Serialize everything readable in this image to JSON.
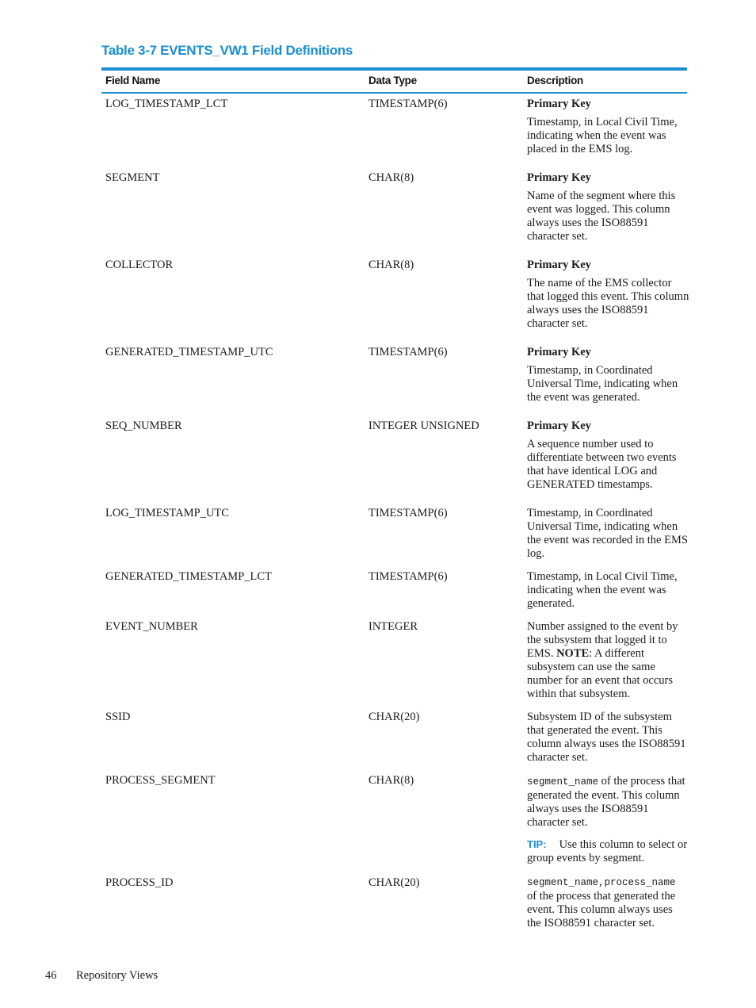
{
  "table": {
    "title": "Table 3-7 EVENTS_VW1 Field Definitions",
    "headers": [
      "Field Name",
      "Data Type",
      "Description"
    ],
    "rows": [
      {
        "field": "LOG_TIMESTAMP_LCT",
        "type": "TIMESTAMP(6)",
        "primary_key": "Primary Key",
        "description": "Timestamp, in Local Civil Time, indicating when the event was placed in the EMS log."
      },
      {
        "field": "SEGMENT",
        "type": "CHAR(8)",
        "primary_key": "Primary Key",
        "description": "Name of the segment where this event was logged. This column always uses the ISO88591 character set."
      },
      {
        "field": "COLLECTOR",
        "type": "CHAR(8)",
        "primary_key": "Primary Key",
        "description": "The name of the EMS collector that logged this event. This column always uses the ISO88591 character set."
      },
      {
        "field": "GENERATED_TIMESTAMP_UTC",
        "type": "TIMESTAMP(6)",
        "primary_key": "Primary Key",
        "description": "Timestamp, in Coordinated Universal Time, indicating when the event was generated."
      },
      {
        "field": "SEQ_NUMBER",
        "type": "INTEGER UNSIGNED",
        "primary_key": "Primary Key",
        "description": "A sequence number used to differentiate between two events that have identical LOG and GENERATED timestamps."
      },
      {
        "field": "LOG_TIMESTAMP_UTC",
        "type": "TIMESTAMP(6)",
        "description": "Timestamp, in Coordinated Universal Time, indicating when the event was recorded in the EMS log."
      },
      {
        "field": "GENERATED_TIMESTAMP_LCT",
        "type": "TIMESTAMP(6)",
        "description": "Timestamp, in Local Civil Time, indicating when the event was generated."
      },
      {
        "field": "EVENT_NUMBER",
        "type": "INTEGER",
        "description_pre": "Number assigned to the event by the subsystem that logged it to EMS.",
        "note_label": "NOTE",
        "description_post": ": A different subsystem can use the same number for an event that occurs within that subsystem."
      },
      {
        "field": "SSID",
        "type": "CHAR(20)",
        "description": "Subsystem ID of the subsystem that generated the event. This column always uses the ISO88591 character set."
      },
      {
        "field": "PROCESS_SEGMENT",
        "type": "CHAR(8)",
        "code": "segment_name",
        "description": " of the process that generated the event. This column always uses the ISO88591 character set.",
        "tip_label": "TIP:",
        "tip": "Use this column to select or group events by segment."
      },
      {
        "field": "PROCESS_ID",
        "type": "CHAR(20)",
        "code": "segment_name,process_name",
        "description": " of the process that generated the event. This column always uses the ISO88591 character set."
      }
    ]
  },
  "footer": {
    "page_number": "46",
    "section": "Repository Views"
  },
  "colors": {
    "accent": "#1a8fd0"
  }
}
